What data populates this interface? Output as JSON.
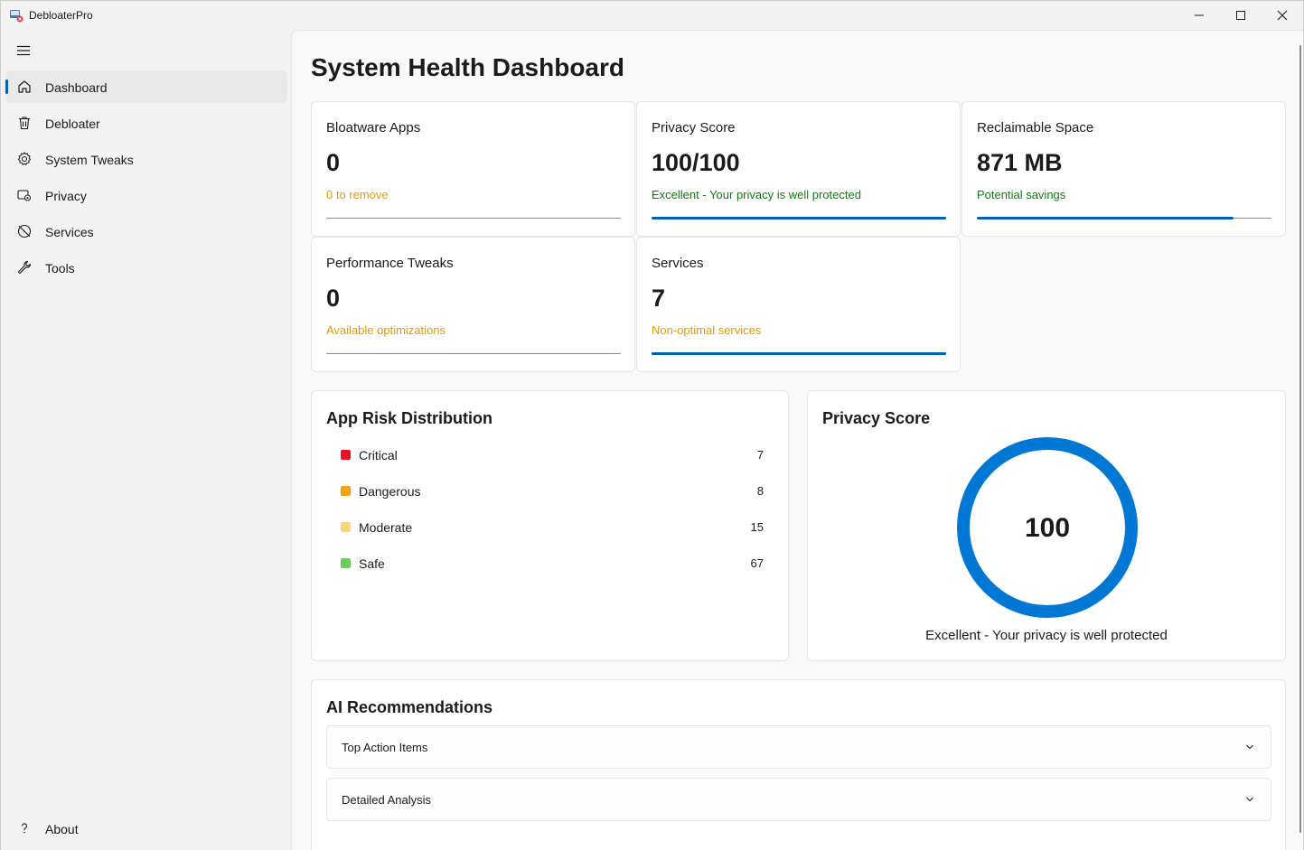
{
  "window": {
    "title": "DebloaterPro"
  },
  "sidebar": {
    "items": [
      {
        "label": "Dashboard",
        "icon": "home-icon",
        "active": true
      },
      {
        "label": "Debloater",
        "icon": "trash-icon",
        "active": false
      },
      {
        "label": "System Tweaks",
        "icon": "gear-icon",
        "active": false
      },
      {
        "label": "Privacy",
        "icon": "privacy-icon",
        "active": false
      },
      {
        "label": "Services",
        "icon": "services-icon",
        "active": false
      },
      {
        "label": "Tools",
        "icon": "wrench-icon",
        "active": false
      }
    ],
    "footer_item": {
      "label": "About",
      "icon": "question-icon"
    }
  },
  "page": {
    "title": "System Health Dashboard"
  },
  "stats": [
    {
      "title": "Bloatware Apps",
      "value": "0",
      "subtitle": "0 to remove",
      "subtitle_color": "#e39a00",
      "progress": 0
    },
    {
      "title": "Privacy Score",
      "value": "100/100",
      "subtitle": "Excellent - Your privacy is well protected",
      "subtitle_color": "#0f7b0f",
      "progress": 1.0
    },
    {
      "title": "Reclaimable Space",
      "value": "871 MB",
      "subtitle": "Potential savings",
      "subtitle_color": "#0f7b0f",
      "progress": 0.87
    },
    {
      "title": "Performance Tweaks",
      "value": "0",
      "subtitle": "Available optimizations",
      "subtitle_color": "#e39a00",
      "progress": 0
    },
    {
      "title": "Services",
      "value": "7",
      "subtitle": "Non-optimal services",
      "subtitle_color": "#e39a00",
      "progress": 1.0
    }
  ],
  "risk": {
    "title": "App Risk Distribution",
    "rows": [
      {
        "label": "Critical",
        "count": "7",
        "color": "#e81123"
      },
      {
        "label": "Dangerous",
        "count": "8",
        "color": "#f7a20d"
      },
      {
        "label": "Moderate",
        "count": "15",
        "color": "#ffd37a"
      },
      {
        "label": "Safe",
        "count": "67",
        "color": "#6ccb5f"
      }
    ]
  },
  "privacy_card": {
    "title": "Privacy Score",
    "value": "100",
    "score_fraction": 1.0,
    "caption": "Excellent - Your privacy is well protected",
    "ring_color": "#0078d4"
  },
  "ai": {
    "title": "AI Recommendations",
    "sections": [
      {
        "label": "Top Action Items"
      },
      {
        "label": "Detailed Analysis"
      }
    ]
  },
  "colors": {
    "accent": "#005fb8"
  }
}
